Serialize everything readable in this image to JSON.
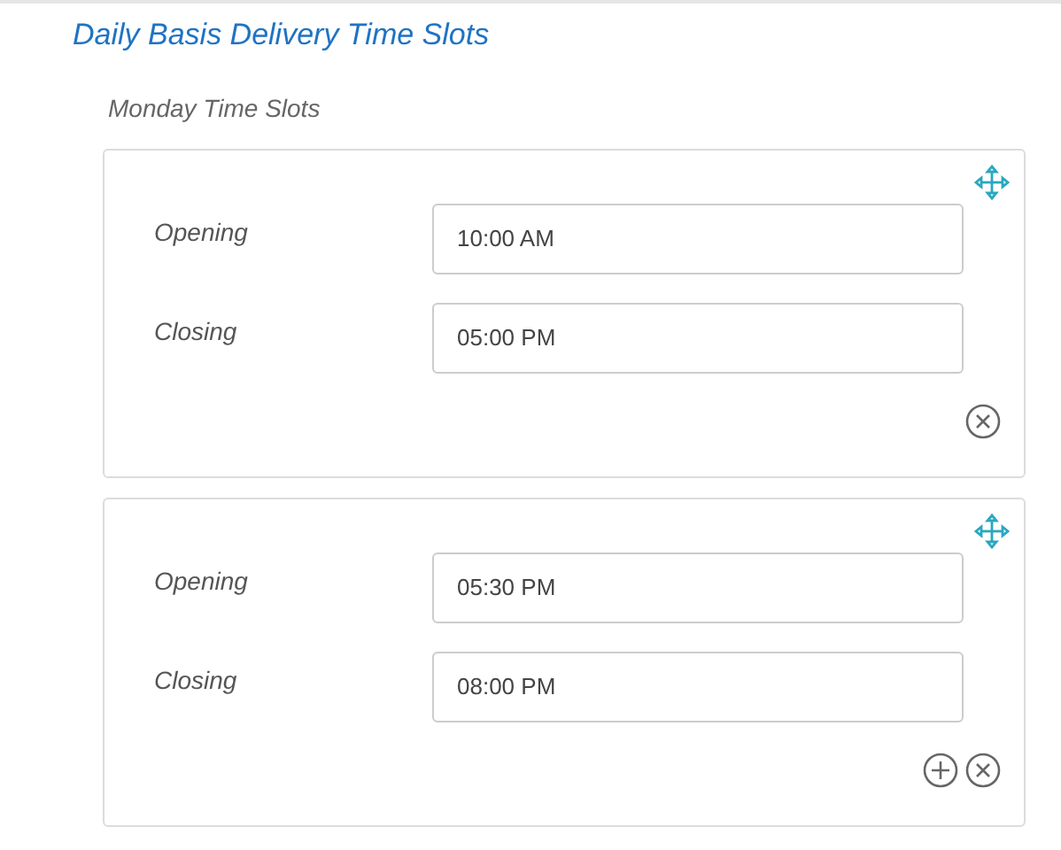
{
  "title": "Daily Basis Delivery Time Slots",
  "day_heading": "Monday Time Slots",
  "slots": [
    {
      "fields": [
        {
          "label": "Opening",
          "value": "10:00 AM"
        },
        {
          "label": "Closing",
          "value": "05:00 PM"
        }
      ],
      "addable": false
    },
    {
      "fields": [
        {
          "label": "Opening",
          "value": "05:30 PM"
        },
        {
          "label": "Closing",
          "value": "08:00 PM"
        }
      ],
      "addable": true
    }
  ]
}
